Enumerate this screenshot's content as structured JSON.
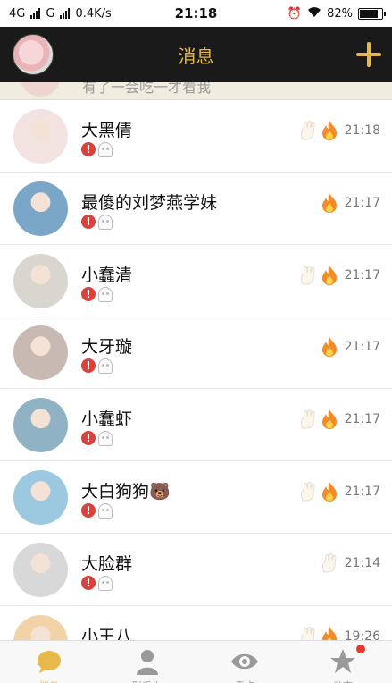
{
  "status_bar": {
    "network1": "4G",
    "network2": "G",
    "speed": "0.4K/s",
    "time": "21:18",
    "battery": "82%",
    "battery_level": 0.82
  },
  "header": {
    "title": "消息",
    "add_icon": "plus-icon",
    "accent_color": "#e8b84a"
  },
  "peek_row": {
    "text": "有了一会吃一才看我"
  },
  "conversations": [
    {
      "name": "大黑倩",
      "time": "21:18",
      "hand": true,
      "fire": true,
      "avatar_color": "#f3e3e0"
    },
    {
      "name": "最傻的刘梦燕学妹",
      "time": "21:17",
      "hand": false,
      "fire": true,
      "avatar_color": "#7aa6c8"
    },
    {
      "name": "小蠢清",
      "time": "21:17",
      "hand": true,
      "fire": true,
      "avatar_color": "#d9d6cf"
    },
    {
      "name": "大牙璇",
      "time": "21:17",
      "hand": false,
      "fire": true,
      "avatar_color": "#c9b9b3"
    },
    {
      "name": "小蠢虾",
      "time": "21:17",
      "hand": true,
      "fire": true,
      "avatar_color": "#8fb2c4"
    },
    {
      "name": "大白狗狗🐻",
      "time": "21:17",
      "hand": true,
      "fire": true,
      "avatar_color": "#9cc8e0"
    },
    {
      "name": "大脸群",
      "time": "21:14",
      "hand": true,
      "fire": false,
      "avatar_color": "#d8d8d8"
    },
    {
      "name": "小王八",
      "time": "19:26",
      "hand": true,
      "fire": true,
      "avatar_color": "#f2d3a8"
    }
  ],
  "tabs": [
    {
      "label": "消息",
      "icon": "chat-bubble-icon",
      "active": true,
      "badge": false
    },
    {
      "label": "联系人",
      "icon": "contacts-icon",
      "active": false,
      "badge": false
    },
    {
      "label": "看点",
      "icon": "eye-icon",
      "active": false,
      "badge": false
    },
    {
      "label": "动态",
      "icon": "star-icon",
      "active": false,
      "badge": true
    }
  ]
}
